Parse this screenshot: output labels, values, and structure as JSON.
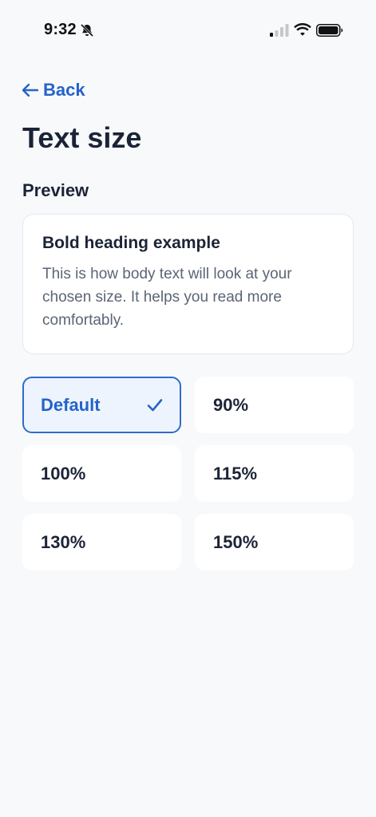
{
  "status_bar": {
    "time": "9:32"
  },
  "nav": {
    "back_label": "Back"
  },
  "page": {
    "title": "Text size",
    "section_label": "Preview"
  },
  "preview": {
    "heading": "Bold heading example",
    "body": "This is how body text will look at your chosen size. It helps you read more comfortably."
  },
  "options": [
    {
      "label": "Default",
      "selected": true
    },
    {
      "label": "90%",
      "selected": false
    },
    {
      "label": "100%",
      "selected": false
    },
    {
      "label": "115%",
      "selected": false
    },
    {
      "label": "130%",
      "selected": false
    },
    {
      "label": "150%",
      "selected": false
    }
  ],
  "colors": {
    "accent": "#2563c9",
    "background": "#f8f9fb",
    "text": "#1b2437",
    "selected_bg": "#eef4fd"
  },
  "icons": {
    "status": [
      "bell-off-icon",
      "signal-icon",
      "wifi-icon",
      "battery-icon"
    ],
    "back": "arrow-left-icon",
    "selected": "checkmark-icon"
  }
}
